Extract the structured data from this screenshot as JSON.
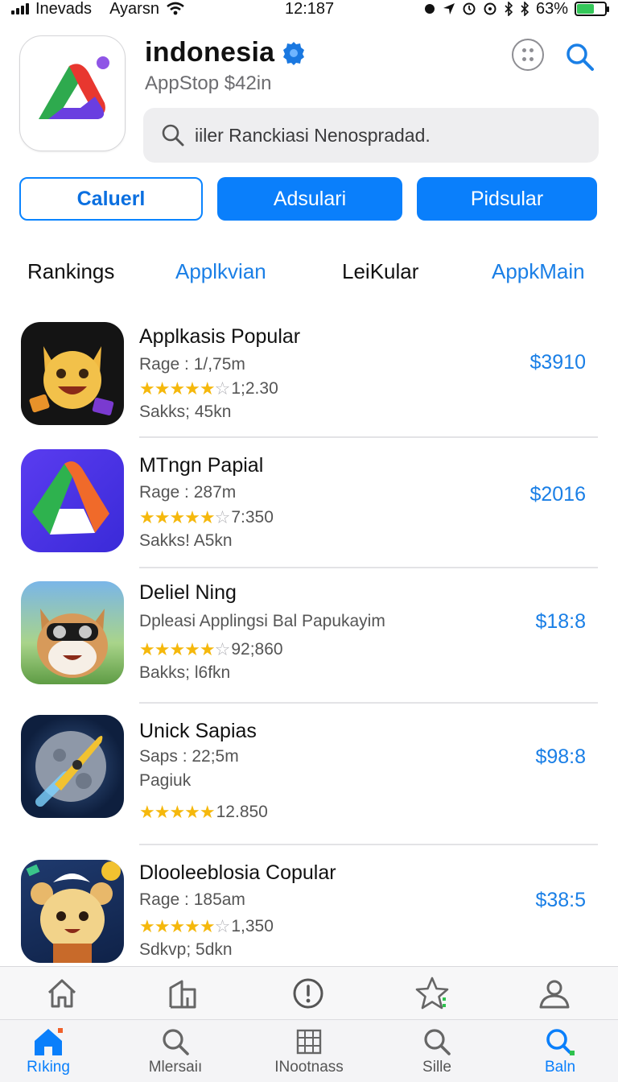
{
  "status_bar": {
    "carrier": "Inevads",
    "network": "Ayarsn",
    "time": "12:187",
    "battery": "63%",
    "battery_level": 0.63
  },
  "header": {
    "title": "indonesia",
    "subtitle": "AppStop $42in",
    "search_placeholder": "iiler Ranckiasi Nenospradad."
  },
  "buttons": {
    "outline": "Caluerl",
    "solid_1": "Adsulari",
    "solid_2": "Pidsular"
  },
  "tabs": [
    "Rankings",
    "Applkvian",
    "LeiKular",
    "AppkMain"
  ],
  "apps": [
    {
      "name": "Applkasis Popular",
      "line1": "Rage : 1/,75m",
      "rating_count": "1;2.30",
      "line3": "Sakks; 45kn",
      "price": "$3910",
      "rating": 4.5,
      "accent": "#f0a830"
    },
    {
      "name": "MTngn Papial",
      "line1": "Rage : 287m",
      "rating_count": "7:350",
      "line3": "Sakks! A5kn",
      "price": "$2016",
      "rating": 4.5,
      "accent": "#5b3df0"
    },
    {
      "name": "Deliel Ning",
      "line1": "Dpleasi Applingsi Bal Papukayim",
      "rating_count": "92;860",
      "line3": "Bakks; l6fkn",
      "price": "$18:8",
      "rating": 4.5,
      "accent": "#e7b07a"
    },
    {
      "name": "Unick Sapias",
      "line1": "Saps : 22;5m",
      "rating_count": "12.850",
      "line3": "Pagiuk",
      "price": "$98:8",
      "rating": 5,
      "accent": "#1f3a6e"
    },
    {
      "name": "Dlooleeblosia Copular",
      "line1": "Rage : 185am",
      "rating_count": "1,350",
      "line3": "Sdkvp; 5dkn",
      "price": "$38:5",
      "rating": 4.5,
      "accent": "#f2d38a"
    }
  ],
  "bottom_upper": [
    "home-outline-icon",
    "building-icon",
    "info-circle-icon",
    "star-outline-icon",
    "person-icon"
  ],
  "bottom_nav": [
    {
      "label": "Rıking",
      "icon": "home-icon",
      "active": true
    },
    {
      "label": "Mlersaiı",
      "icon": "search-icon",
      "active": false
    },
    {
      "label": "INootnass",
      "icon": "grid-icon",
      "active": false
    },
    {
      "label": "Sille",
      "icon": "search-icon",
      "active": false
    },
    {
      "label": "Baln",
      "icon": "search-icon",
      "active": true
    }
  ]
}
